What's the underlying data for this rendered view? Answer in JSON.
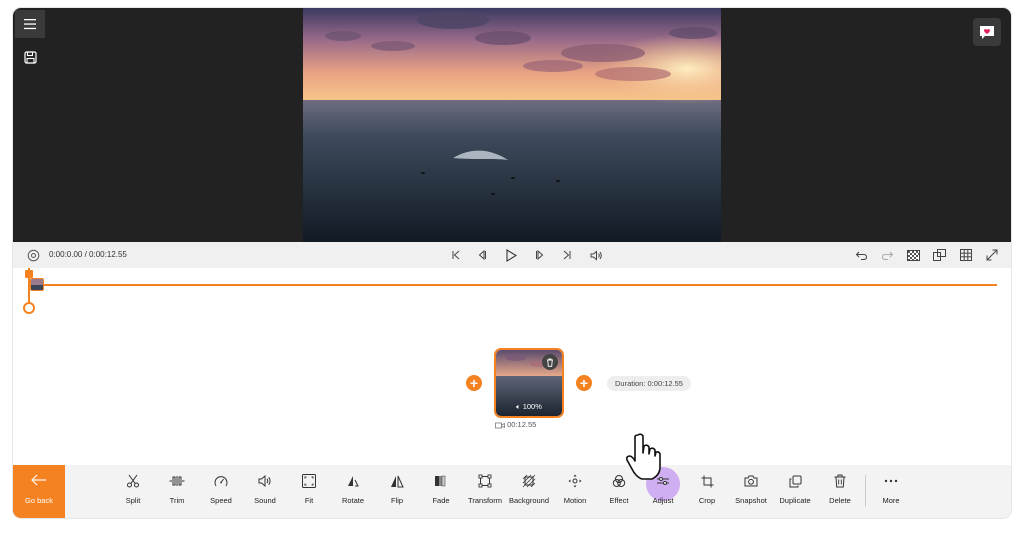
{
  "preview": {
    "menu_icon": "hamburger-menu-icon",
    "save_icon": "save-icon",
    "feedback_icon": "feedback-heart-icon"
  },
  "playbar": {
    "timecode": "0:00:0.00 / 0:00:12.55",
    "left_icons": [
      "settings-icon"
    ],
    "center_icons": [
      "skip-to-start-icon",
      "previous-frame-icon",
      "play-icon",
      "next-frame-icon",
      "skip-to-end-icon",
      "volume-icon"
    ],
    "right_icons": [
      "undo-icon",
      "redo-icon",
      "background-pattern-icon",
      "aspect-ratio-icon",
      "grid-icon",
      "fullscreen-icon"
    ]
  },
  "timeline": {
    "clip_volume": "100%",
    "clip_duration": "00:12.55",
    "duration_label": "Duration: 0:00:12.55"
  },
  "toolbar": {
    "go_back": "Go back",
    "tools": [
      "Split",
      "Trim",
      "Speed",
      "Sound",
      "Fit",
      "Rotate",
      "Flip",
      "Fade",
      "Transform",
      "Background",
      "Motion",
      "Effect",
      "Adjust",
      "Crop",
      "Snapshot",
      "Duplicate",
      "Delete",
      "More"
    ],
    "active_tool": "Adjust"
  },
  "colors": {
    "accent": "#f58220",
    "preview_bg": "#222222",
    "highlight": "#c8a2f0"
  }
}
